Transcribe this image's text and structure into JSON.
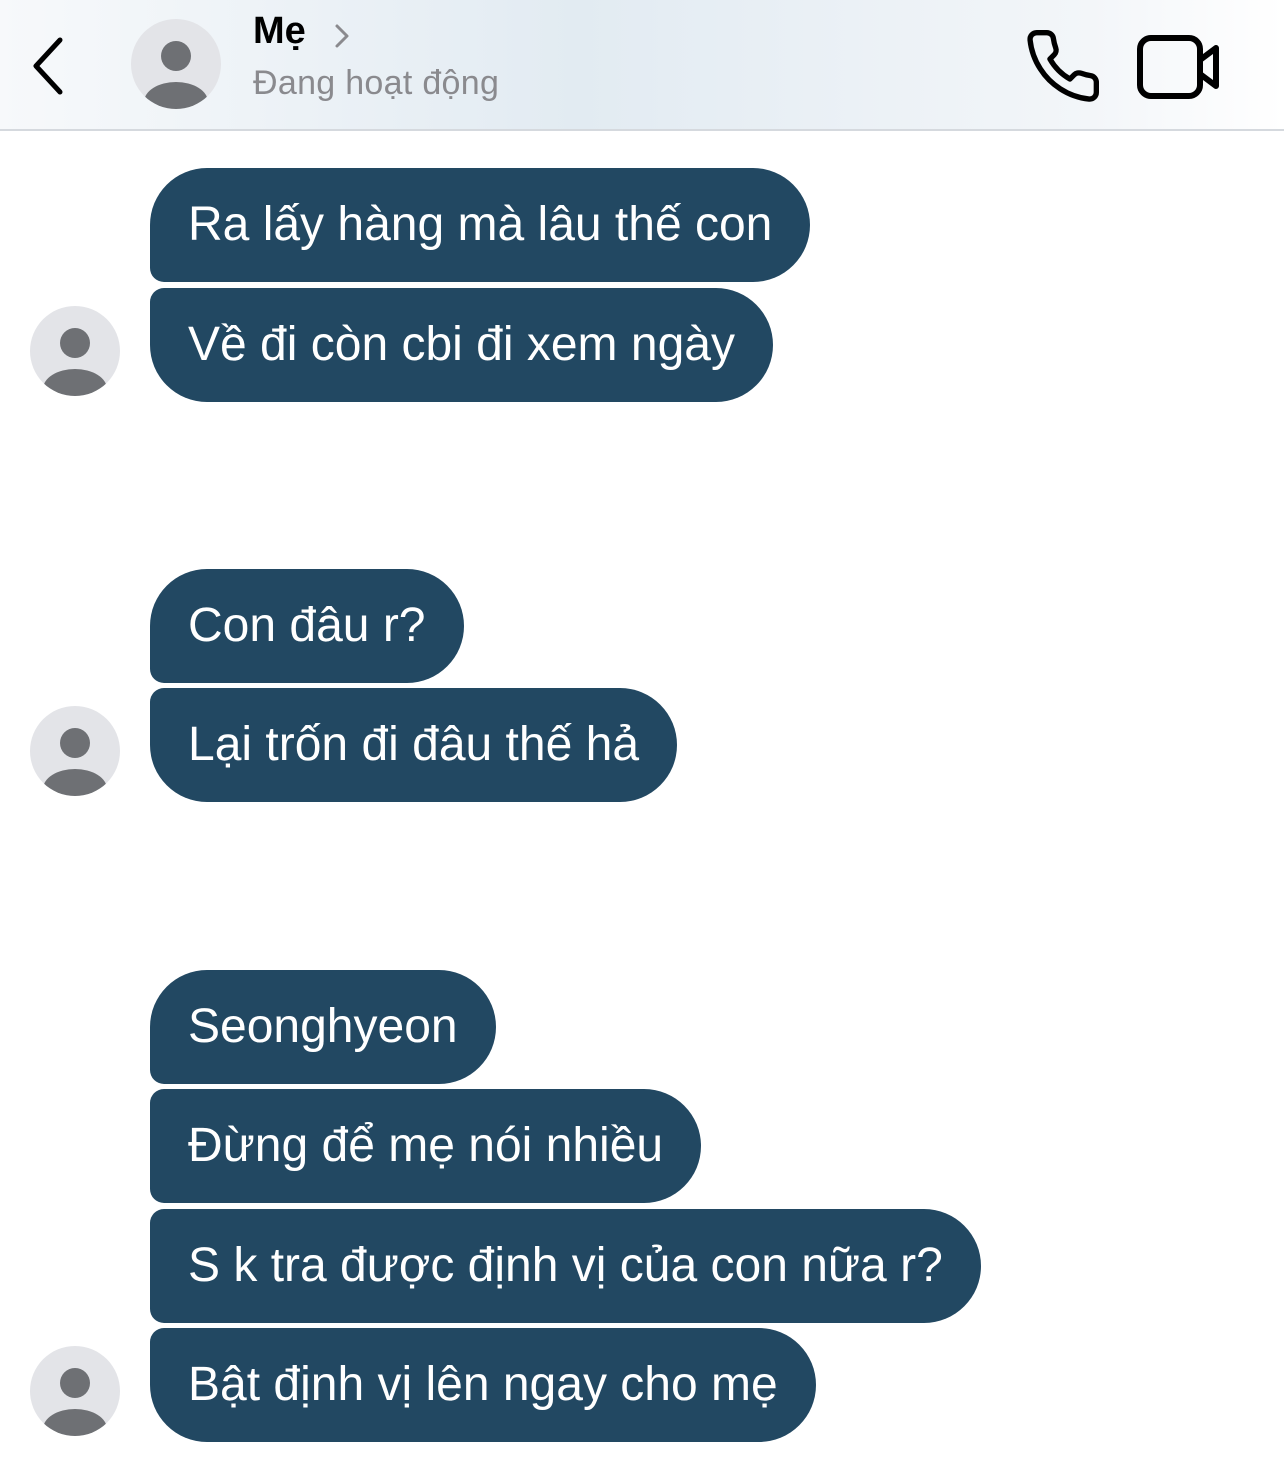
{
  "header": {
    "contact_name": "Mẹ",
    "status": "Đang hoạt động",
    "icons": {
      "back": "chevron-left-icon",
      "call": "phone-icon",
      "video": "video-camera-icon",
      "name_chevron": "chevron-right-icon"
    }
  },
  "colors": {
    "bubble": "#224862",
    "bubble_text": "#ffffff",
    "status_text": "#8a8a8e",
    "avatar_bg": "#e3e4e8",
    "avatar_fg": "#6e7074"
  },
  "messages": [
    {
      "group": 1,
      "text": "Ra lấy hàng mà lâu thế con"
    },
    {
      "group": 1,
      "text": "Về đi còn cbi đi xem ngày"
    },
    {
      "group": 2,
      "text": "Con đâu r?"
    },
    {
      "group": 2,
      "text": "Lại trốn đi đâu thế hả"
    },
    {
      "group": 3,
      "text": "Seonghyeon"
    },
    {
      "group": 3,
      "text": "Đừng để mẹ nói nhiều"
    },
    {
      "group": 3,
      "text": "S k tra được định vị của con nữa r?"
    },
    {
      "group": 3,
      "text": "Bật định vị lên ngay cho mẹ"
    }
  ]
}
